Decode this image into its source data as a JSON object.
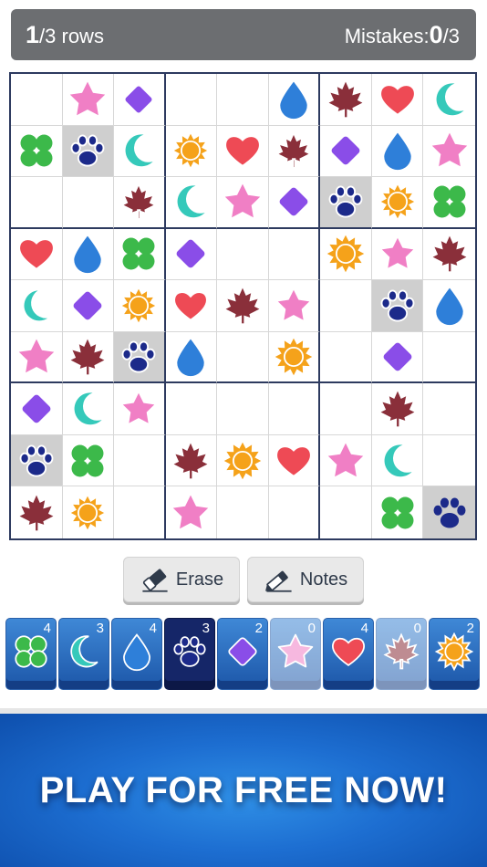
{
  "status": {
    "rows_done": "1",
    "rows_total": "/3 rows",
    "mistakes_label": "Mistakes: ",
    "mistakes_value": "0",
    "mistakes_total": "/3"
  },
  "colors": {
    "clover": "#3cb94a",
    "moon": "#35c9ba",
    "drop": "#2e7fd9",
    "paw": "#1c2a8a",
    "diamond": "#8a4de8",
    "star": "#f07fc5",
    "heart": "#ee4a55",
    "leaf": "#8a2f3a",
    "sun": "#f5a21a"
  },
  "board": {
    "cells": [
      [
        "",
        "star",
        "diamond",
        "",
        "",
        "drop",
        "leaf",
        "heart",
        "moon"
      ],
      [
        "clover",
        "paw",
        "moon",
        "sun",
        "heart",
        "leaf",
        "diamond",
        "drop",
        "star"
      ],
      [
        "",
        "",
        "leaf",
        "moon",
        "star",
        "diamond",
        "paw",
        "sun",
        "clover"
      ],
      [
        "heart",
        "drop",
        "clover",
        "diamond",
        "",
        "",
        "sun",
        "star",
        "leaf"
      ],
      [
        "moon",
        "diamond",
        "sun",
        "heart",
        "leaf",
        "star",
        "",
        "paw",
        "drop"
      ],
      [
        "star",
        "leaf",
        "paw",
        "drop",
        "",
        "sun",
        "",
        "diamond",
        ""
      ],
      [
        "diamond",
        "moon",
        "star",
        "",
        "",
        "",
        "",
        "leaf",
        ""
      ],
      [
        "paw",
        "clover",
        "",
        "leaf",
        "sun",
        "heart",
        "star",
        "moon",
        ""
      ],
      [
        "leaf",
        "sun",
        "",
        "star",
        "",
        "",
        "",
        "clover",
        "paw"
      ]
    ],
    "outlined": [
      [
        0,
        2
      ],
      [
        1,
        1
      ],
      [
        1,
        3
      ],
      [
        1,
        5
      ],
      [
        2,
        2
      ],
      [
        2,
        6
      ],
      [
        2,
        7
      ],
      [
        3,
        7
      ],
      [
        4,
        0
      ],
      [
        4,
        2
      ],
      [
        4,
        3
      ],
      [
        4,
        5
      ],
      [
        4,
        7
      ],
      [
        5,
        2
      ],
      [
        6,
        2
      ],
      [
        7,
        0
      ],
      [
        8,
        1
      ]
    ],
    "highlighted": [
      [
        1,
        1
      ],
      [
        2,
        6
      ],
      [
        4,
        7
      ],
      [
        5,
        2
      ],
      [
        7,
        0
      ],
      [
        8,
        8
      ]
    ]
  },
  "tools": {
    "erase_label": "Erase",
    "notes_label": "Notes"
  },
  "palette": [
    {
      "icon": "clover",
      "count": "4",
      "state": "normal"
    },
    {
      "icon": "moon",
      "count": "3",
      "state": "normal"
    },
    {
      "icon": "drop",
      "count": "4",
      "state": "normal"
    },
    {
      "icon": "paw",
      "count": "3",
      "state": "selected"
    },
    {
      "icon": "diamond",
      "count": "2",
      "state": "normal"
    },
    {
      "icon": "star",
      "count": "0",
      "state": "used"
    },
    {
      "icon": "heart",
      "count": "4",
      "state": "normal"
    },
    {
      "icon": "leaf",
      "count": "0",
      "state": "used"
    },
    {
      "icon": "sun",
      "count": "2",
      "state": "normal"
    }
  ],
  "banner": {
    "text": "PLAY FOR FREE NOW!"
  }
}
